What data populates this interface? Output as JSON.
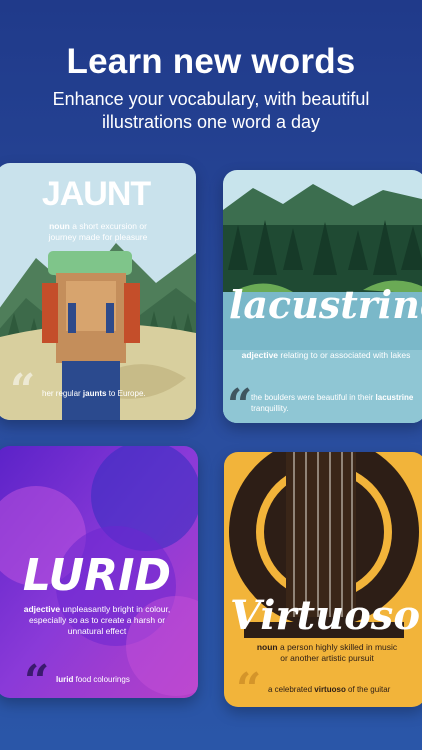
{
  "header": {
    "title": "Learn new words",
    "subtitle": "Enhance your vocabulary, with beautiful illustrations one word a day"
  },
  "cards": [
    {
      "word": "JAUNT",
      "pos": "noun",
      "definition": "a short excursion or journey made for pleasure",
      "example_before": "her regular ",
      "example_word": "jaunts",
      "example_after": " to Europe."
    },
    {
      "word": "lacustrine",
      "pos": "adjective",
      "definition": "relating to or associated with lakes",
      "example_before": "the boulders were beautiful in their ",
      "example_word": "lacustrine",
      "example_after": " tranquillity."
    },
    {
      "word": "LURID",
      "pos": "adjective",
      "definition": "unpleasantly bright in colour, especially so as to create a harsh or unnatural effect",
      "example_before": "",
      "example_word": "lurid",
      "example_after": " food colourings"
    },
    {
      "word": "Virtuoso",
      "pos": "noun",
      "definition": "a person highly skilled in music or another artistic pursuit",
      "example_before": "a celebrated ",
      "example_word": "virtuoso",
      "example_after": " of the guitar"
    }
  ],
  "colors": {
    "background": "#203a8a",
    "jaunt_sky": "#c8e0ea",
    "lake_water": "#7ab8c9",
    "lurid_purple": "#7a2fd0",
    "virtuoso_yellow": "#f2b43a"
  }
}
